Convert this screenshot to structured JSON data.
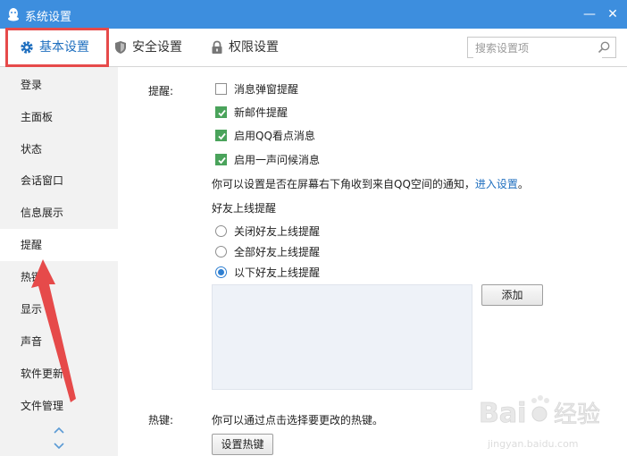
{
  "window": {
    "title": "系统设置",
    "minimize_glyph": "—",
    "close_glyph": "✕"
  },
  "tabs": [
    {
      "label": "基本设置",
      "icon": "gear-icon",
      "active": true
    },
    {
      "label": "安全设置",
      "icon": "shield-icon",
      "active": false
    },
    {
      "label": "权限设置",
      "icon": "lock-icon",
      "active": false
    }
  ],
  "search": {
    "placeholder": "搜索设置项"
  },
  "sidebar": {
    "items": [
      {
        "label": "登录"
      },
      {
        "label": "主面板"
      },
      {
        "label": "状态"
      },
      {
        "label": "会话窗口"
      },
      {
        "label": "信息展示"
      },
      {
        "label": "提醒",
        "active": true
      },
      {
        "label": "热键"
      },
      {
        "label": "显示"
      },
      {
        "label": "声音"
      },
      {
        "label": "软件更新"
      },
      {
        "label": "文件管理"
      }
    ]
  },
  "reminder": {
    "section_label": "提醒:",
    "checkboxes": [
      {
        "label": "消息弹窗提醒",
        "checked": false
      },
      {
        "label": "新邮件提醒",
        "checked": true
      },
      {
        "label": "启用QQ看点消息",
        "checked": true
      },
      {
        "label": "启用一声问候消息",
        "checked": true
      }
    ],
    "info_text": "你可以设置是否在屏幕右下角收到来自QQ空间的通知，",
    "info_link": "进入设置",
    "info_end": "。",
    "friend_title": "好友上线提醒",
    "radios": [
      {
        "label": "关闭好友上线提醒",
        "checked": false
      },
      {
        "label": "全部好友上线提醒",
        "checked": false
      },
      {
        "label": "以下好友上线提醒",
        "checked": true
      }
    ],
    "add_button": "添加"
  },
  "hotkey": {
    "section_label": "热键:",
    "desc": "你可以通过点击选择要更改的热键。",
    "button": "设置热键"
  },
  "colors": {
    "titlebar": "#3d8ede",
    "accent": "#1f6fbf",
    "annotation": "#e64a4a",
    "check_green": "#4aa35b"
  },
  "watermark": {
    "brand": "Bai",
    "brand2": "经验",
    "url": "jingyan.baidu.com"
  }
}
